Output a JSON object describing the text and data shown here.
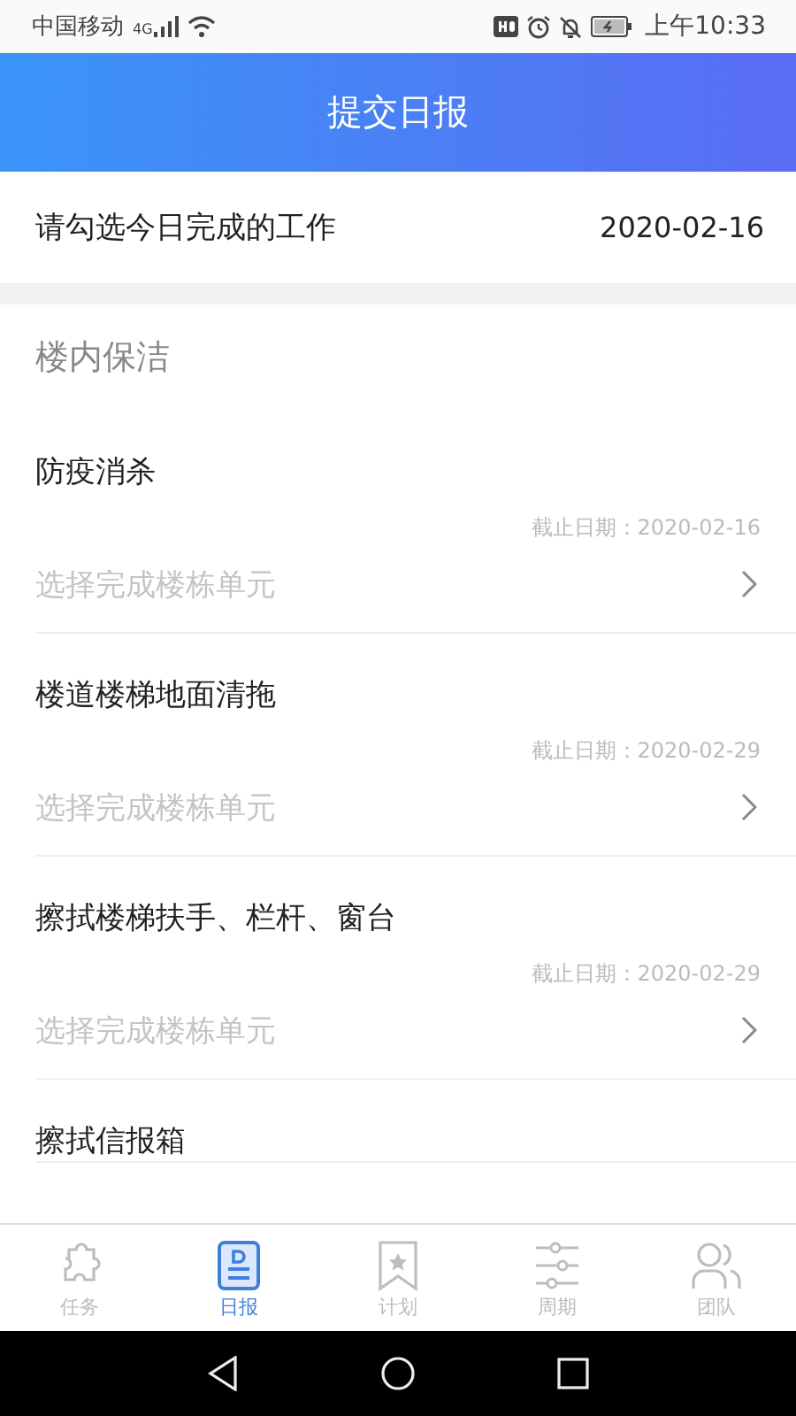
{
  "status_bar": {
    "carrier": "中国移动",
    "network": "4G",
    "time": "上午10:33"
  },
  "header": {
    "title": "提交日报"
  },
  "summary": {
    "label": "请勾选今日完成的工作",
    "date": "2020-02-16"
  },
  "section": {
    "title": "楼内保洁"
  },
  "tasks": [
    {
      "title": "防疫消杀",
      "deadline": "截止日期：2020-02-16",
      "picker": {
        "placeholder": "选择完成楼栋单元"
      }
    },
    {
      "title": "楼道楼梯地面清拖",
      "deadline": "截止日期：2020-02-29",
      "picker": {
        "placeholder": "选择完成楼栋单元"
      }
    },
    {
      "title": "擦拭楼梯扶手、栏杆、窗台",
      "deadline": "截止日期：2020-02-29",
      "picker": {
        "placeholder": "选择完成楼栋单元"
      }
    },
    {
      "title": "擦拭信报箱"
    }
  ],
  "bottom_nav": [
    {
      "kind": "puzzle",
      "label": "任务",
      "selected": false
    },
    {
      "kind": "report",
      "label": "日报",
      "selected": true
    },
    {
      "kind": "bookmark",
      "label": "计划",
      "selected": false
    },
    {
      "kind": "sliders",
      "label": "周期",
      "selected": false
    },
    {
      "kind": "people",
      "label": "团队",
      "selected": false
    }
  ]
}
